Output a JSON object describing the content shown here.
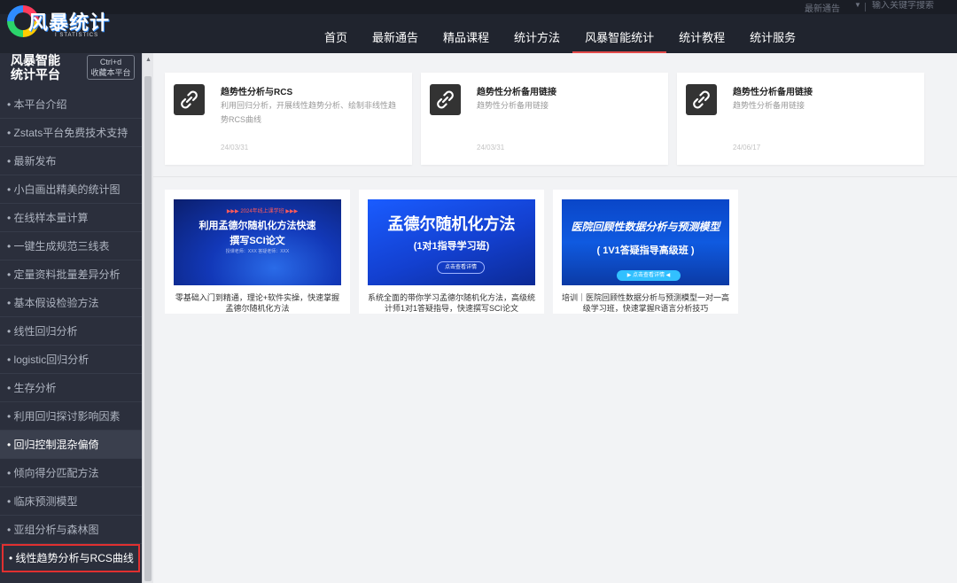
{
  "topbar": {
    "notice": "最新通告",
    "caret": "▼",
    "search_placeholder": "输入关键字搜索"
  },
  "logo": {
    "text": "风暴统计",
    "sub": "I STATISTICS"
  },
  "nav": {
    "items": [
      "首页",
      "最新通告",
      "精品课程",
      "统计方法",
      "风暴智能统计",
      "统计教程",
      "统计服务"
    ],
    "active_index": 4,
    "accent": "#e34a4a"
  },
  "sidebar": {
    "title_line1": "风暴智能",
    "title_line2": "统计平台",
    "bookmark_line1": "Ctrl+d",
    "bookmark_line2": "收藏本平台",
    "items": [
      "• 本平台介绍",
      "• Zstats平台免费技术支持",
      "• 最新发布",
      "• 小白画出精美的统计图",
      "• 在线样本量计算",
      "• 一键生成规范三线表",
      "• 定量资料批量差异分析",
      "• 基本假设检验方法",
      "• 线性回归分析",
      "• logistic回归分析",
      "• 生存分析",
      "• 利用回归探讨影响因素",
      "• 回归控制混杂偏倚",
      "• 倾向得分匹配方法",
      "• 临床预测模型",
      "• 亚组分析与森林图",
      "• 线性趋势分析与RCS曲线"
    ],
    "active_index": 12,
    "current_index": 16,
    "highlight_color": "#e03030"
  },
  "link_cards": [
    {
      "icon": "link-icon",
      "title": "趋势性分析与RCS",
      "desc": "利用回归分析，开展线性趋势分析、绘制非线性趋势RCS曲线",
      "date": "24/03/31"
    },
    {
      "icon": "link-icon",
      "title": "趋势性分析备用链接",
      "desc": "趋势性分析备用链接",
      "date": "24/03/31"
    },
    {
      "icon": "link-icon",
      "title": "趋势性分析备用链接",
      "desc": "趋势性分析备用链接",
      "date": "24/06/17"
    }
  ],
  "course_cards": [
    {
      "tag": "▶▶▶ 2024年线上课学班 ▶▶▶",
      "line1": "利用孟德尔随机化方法快速",
      "line2": "撰写SCI论文",
      "line3": "授课老师：XXX  答疑老师：XXX",
      "caption": "零基础入门到精通，理论+软件实操，快速掌握孟德尔随机化方法"
    },
    {
      "line1": "孟德尔随机化方法",
      "line2": "(1对1指导学习班)",
      "button": "点击查看详情",
      "caption": "系统全面的带你学习孟德尔随机化方法，高级统计师1对1答疑指导，快速撰写SCI论文"
    },
    {
      "line1": "医院回顾性数据分析与预测模型",
      "line2": "( 1V1答疑指导高级班 )",
      "button": "▶ 点击查看详情 ◀",
      "caption": "培训｜医院回顾性数据分析与预测模型一对一高级学习班，快速掌握R语言分析技巧"
    }
  ]
}
